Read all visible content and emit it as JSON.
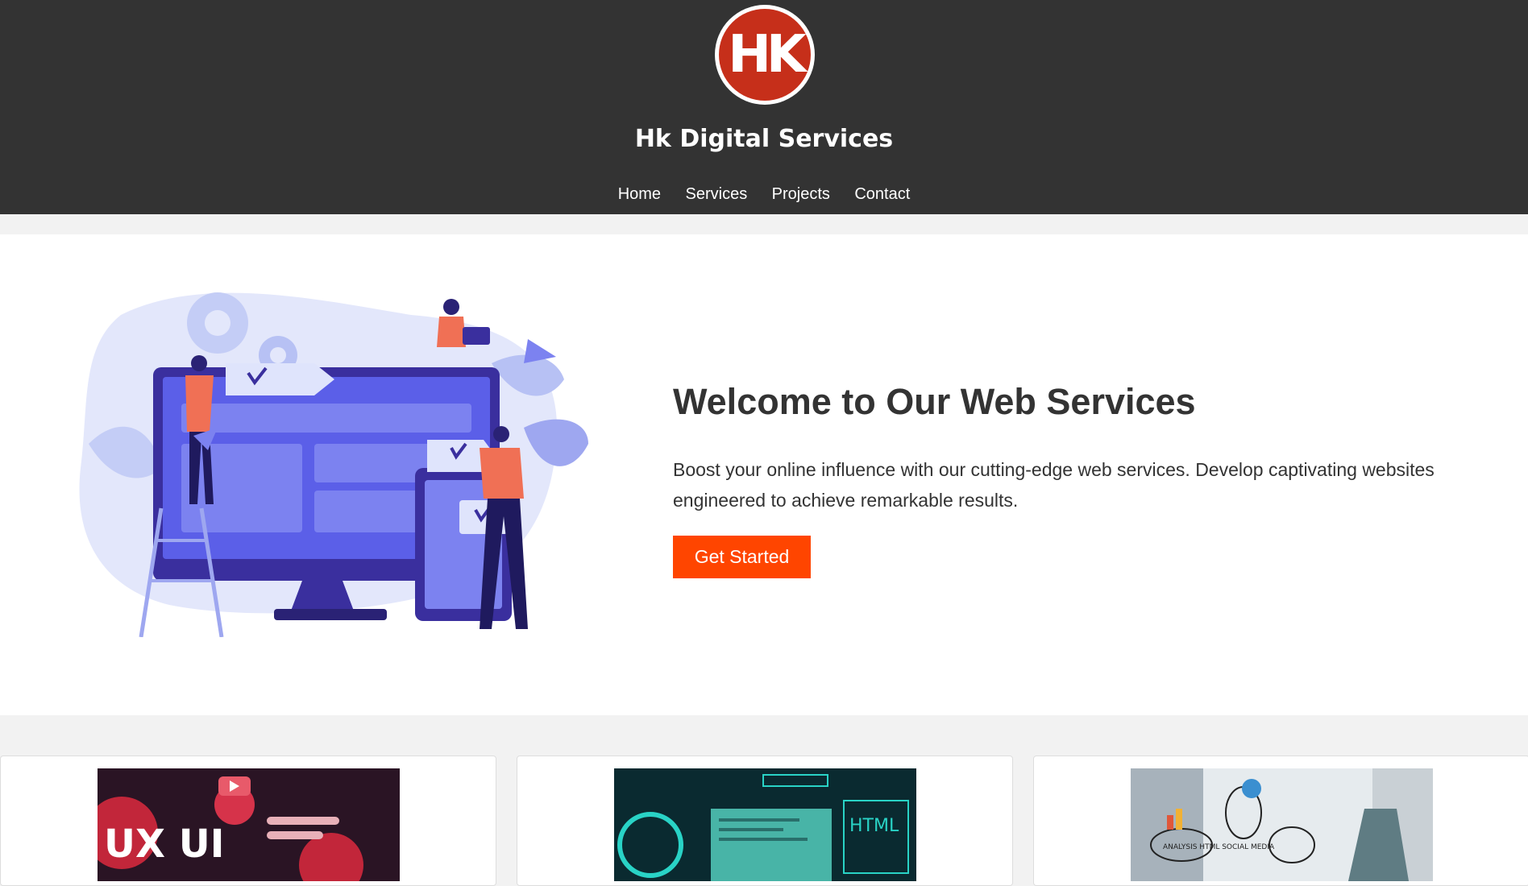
{
  "header": {
    "logo_text": "HK",
    "brand_name": "Hk Digital Services",
    "nav": [
      "Home",
      "Services",
      "Projects",
      "Contact"
    ]
  },
  "hero": {
    "title": "Welcome to Our Web Services",
    "description": "Boost your online influence with our cutting-edge web services. Develop captivating websites engineered to achieve remarkable results.",
    "cta_label": "Get Started"
  },
  "cards": [
    {
      "image_text": "UX UI"
    },
    {
      "image_text": "HTML"
    },
    {
      "image_text": "ANALYSIS HTML SOCIAL MEDIA"
    }
  ],
  "colors": {
    "header_bg": "#333333",
    "accent": "#ff4500",
    "logo_red": "#c62f1a",
    "illustration_blue": "#5b5fe8"
  }
}
